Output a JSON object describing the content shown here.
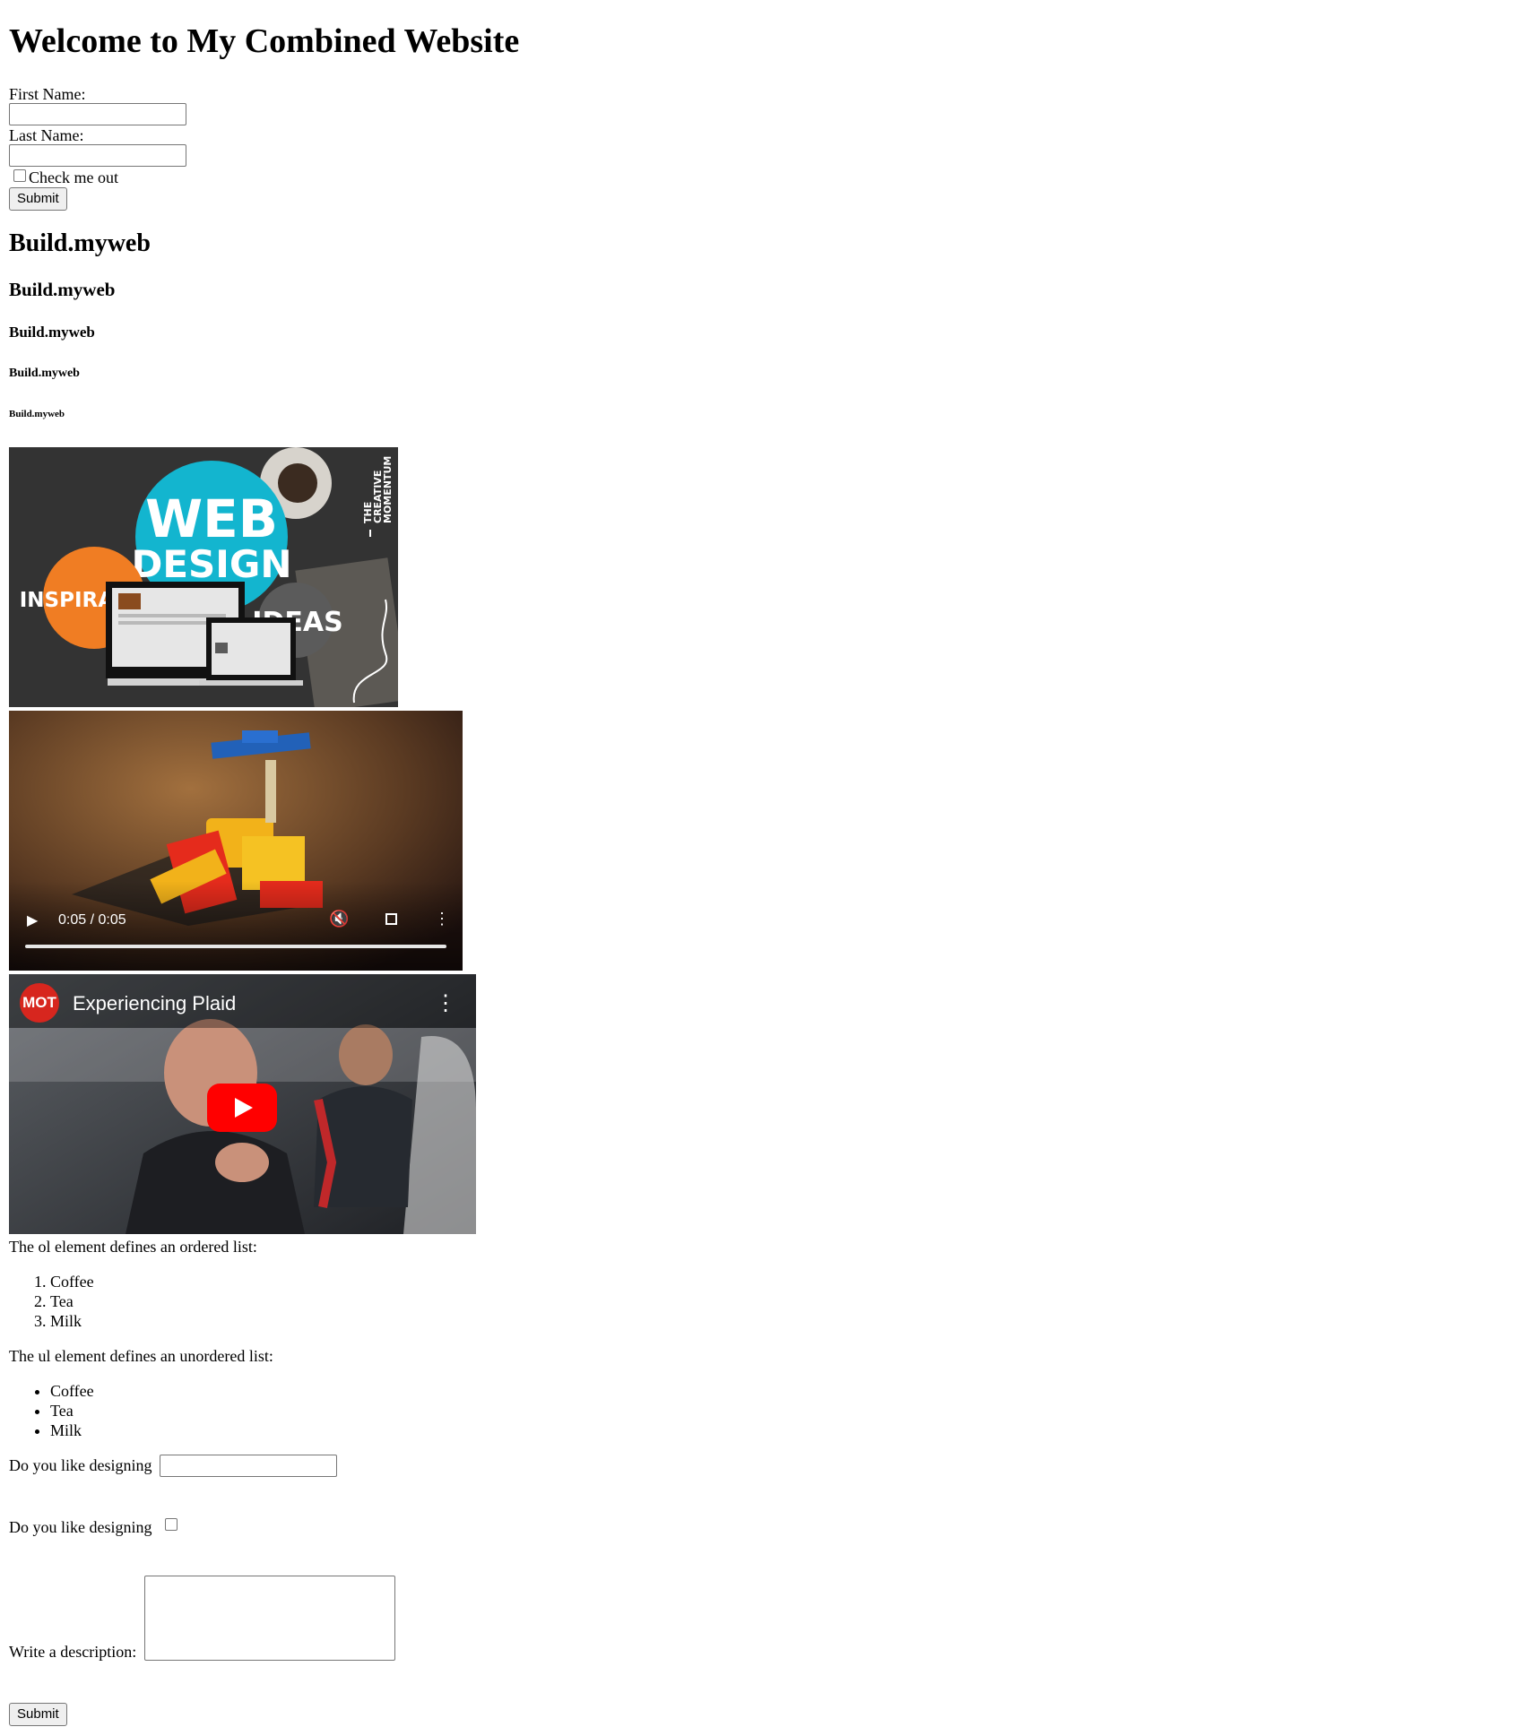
{
  "page": {
    "title": "Welcome to My Combined Website"
  },
  "form1": {
    "first_name_label": "First Name:",
    "first_name_value": "",
    "last_name_label": "Last Name:",
    "last_name_value": "",
    "check_label": "Check me out",
    "check_checked": false,
    "submit_label": "Submit"
  },
  "headings": [
    "Build.myweb",
    "Build.myweb",
    "Build.myweb",
    "Build.myweb",
    "Build.myweb"
  ],
  "image1": {
    "web_text": "WEB",
    "design_text": "DESIGN",
    "inspiration_text": "INSPIRATION",
    "ideas_text": "IDEAS",
    "brand_line1": "THE",
    "brand_line2": "CREATIVE",
    "brand_line3": "MOMENTUM",
    "colors": {
      "cyan": "#13b5cf",
      "orange": "#f07d23",
      "grey": "#5b5b5b",
      "dark": "#2c2c2c"
    }
  },
  "video": {
    "time": "0:05 / 0:05",
    "progress": 1.0,
    "play_icon": "play-icon",
    "mute_icon": "mute-icon",
    "fullscreen_icon": "fullscreen-icon",
    "more_icon": "more-vert-icon"
  },
  "youtube": {
    "channel_badge": "MOT",
    "title": "Experiencing Plaid",
    "play_icon": "youtube-play-icon",
    "more_icon": "more-vert-icon"
  },
  "ordered_list": {
    "intro": "The ol element defines an ordered list:",
    "items": [
      "Coffee",
      "Tea",
      "Milk"
    ]
  },
  "unordered_list": {
    "intro": "The ul element defines an unordered list:",
    "items": [
      "Coffee",
      "Tea",
      "Milk"
    ]
  },
  "form2": {
    "q1_label": "Do you like designing",
    "q1_value": "",
    "q2_label": "Do you like designing",
    "q2_checked": false,
    "desc_label": "Write a description:",
    "desc_value": "",
    "submit_label": "Submit"
  }
}
